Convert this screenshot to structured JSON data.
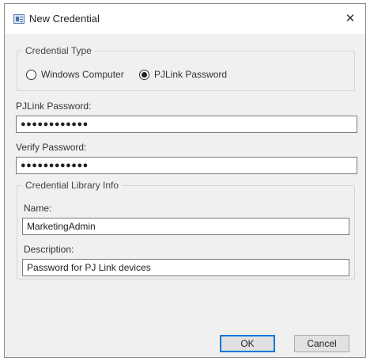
{
  "window": {
    "title": "New Credential",
    "close_symbol": "✕"
  },
  "credential_type": {
    "legend": "Credential Type",
    "options": [
      {
        "label": "Windows Computer",
        "checked": false
      },
      {
        "label": "PJLink Password",
        "checked": true
      }
    ]
  },
  "pjlink_password": {
    "label": "PJLink Password:",
    "value": "●●●●●●●●●●●●"
  },
  "verify_password": {
    "label": "Verify Password:",
    "value": "●●●●●●●●●●●●"
  },
  "library_info": {
    "legend": "Credential Library Info",
    "name_label": "Name:",
    "name_value": "MarketingAdmin",
    "description_label": "Description:",
    "description_value": "Password for PJ Link devices"
  },
  "buttons": {
    "ok": "OK",
    "cancel": "Cancel"
  }
}
